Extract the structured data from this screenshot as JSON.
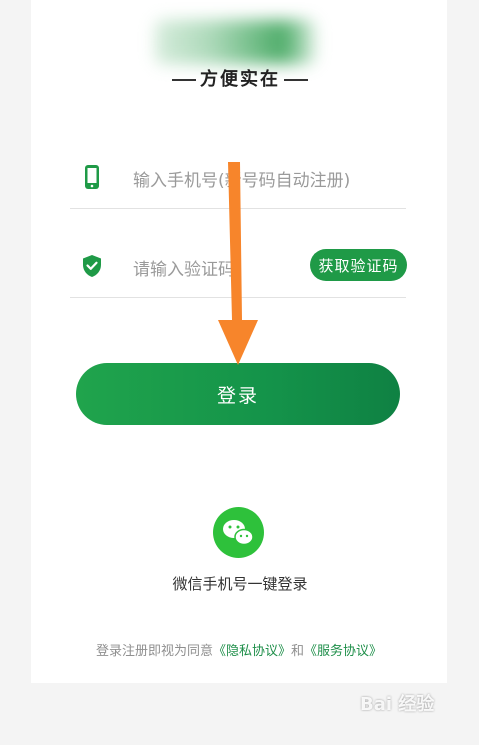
{
  "header": {
    "slogan": "方便实在"
  },
  "form": {
    "phone_placeholder": "输入手机号(新号码自动注册)",
    "code_placeholder": "请输入验证码",
    "get_code_label": "获取验证码",
    "login_label": "登录"
  },
  "wechat": {
    "label": "微信手机号一键登录",
    "icon": "wechat-icon"
  },
  "agreement": {
    "prefix": "登录注册即视为同意",
    "privacy": "《隐私协议》",
    "conj": "和",
    "service": "《服务协议》"
  },
  "colors": {
    "accent": "#1f9a47",
    "arrow": "#f7852b",
    "wechat": "#2ec13b"
  },
  "watermark": {
    "text": "Bai 经验"
  }
}
